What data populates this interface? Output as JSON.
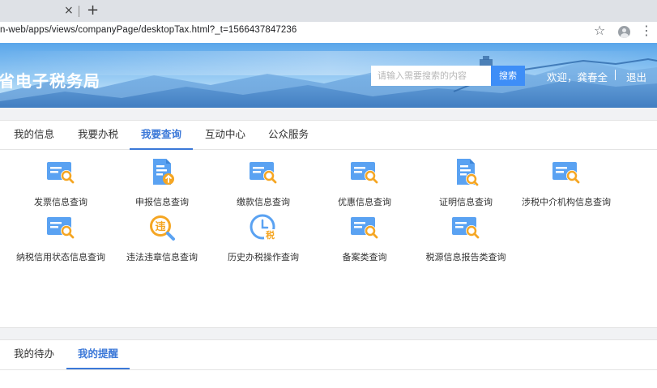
{
  "browser": {
    "tab_close": "×",
    "new_tab": "+",
    "url": "n-web/apps/views/companyPage/desktopTax.html?_t=1566437847236",
    "star_icon": "☆",
    "menu_icon": "⋮"
  },
  "header": {
    "site_title": "省电子税务局",
    "search_placeholder": "请输入需要搜索的内容",
    "search_button": "搜索",
    "welcome": "欢迎，龚春全",
    "logout": "退出"
  },
  "nav_tabs": [
    {
      "label": "我的信息"
    },
    {
      "label": "我要办税"
    },
    {
      "label": "我要查询",
      "active": true
    },
    {
      "label": "互动中心"
    },
    {
      "label": "公众服务"
    }
  ],
  "services": [
    {
      "label": "发票信息查询",
      "icon": "card-search-icon"
    },
    {
      "label": "申报信息查询",
      "icon": "document-upload-icon"
    },
    {
      "label": "缴款信息查询",
      "icon": "card-search-icon"
    },
    {
      "label": "优惠信息查询",
      "icon": "card-search-icon"
    },
    {
      "label": "证明信息查询",
      "icon": "certificate-search-icon"
    },
    {
      "label": "涉税中介机构信息查询",
      "icon": "card-search-icon"
    },
    {
      "label": "纳税信用状态信息查询",
      "icon": "card-search-icon"
    },
    {
      "label": "违法违章信息查询",
      "icon": "tax-search-icon"
    },
    {
      "label": "历史办税操作查询",
      "icon": "clock-tax-icon"
    },
    {
      "label": "备案类查询",
      "icon": "card-search-icon"
    },
    {
      "label": "税源信息报告类查询",
      "icon": "card-search-icon"
    }
  ],
  "bottom_tabs": [
    {
      "label": "我的待办"
    },
    {
      "label": "我的提醒",
      "active": true
    }
  ],
  "colors": {
    "accent": "#3b78d8",
    "icon_blue": "#4a97f0",
    "icon_orange": "#f5a623"
  },
  "icons": {
    "tax_char": "税",
    "violation_char": "违"
  }
}
